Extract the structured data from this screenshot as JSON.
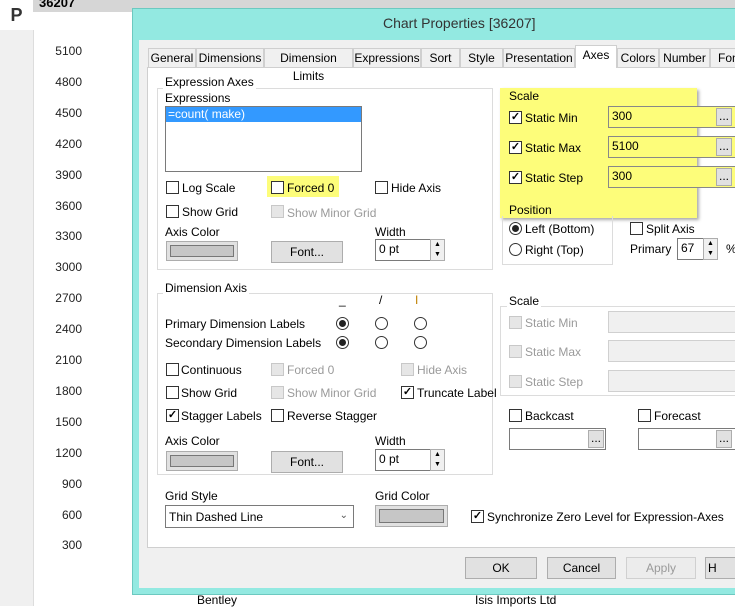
{
  "background": {
    "app_letter": "P",
    "object_id": "36207",
    "y_axis": [
      "5100",
      "4800",
      "4500",
      "4200",
      "3900",
      "3600",
      "3300",
      "3000",
      "2700",
      "2400",
      "2100",
      "1800",
      "1500",
      "1200",
      "900",
      "600",
      "300"
    ],
    "x_labels": [
      "Bentley",
      "Isis Imports Ltd"
    ]
  },
  "dialog": {
    "title": "Chart Properties [36207]",
    "accent": "#93e9e1",
    "tabs": [
      "General",
      "Dimensions",
      "Dimension Limits",
      "Expressions",
      "Sort",
      "Style",
      "Presentation",
      "Axes",
      "Colors",
      "Number",
      "Font"
    ],
    "active_tab": "Axes",
    "expr_axes": {
      "group": "Expression Axes",
      "expressions_label": "Expressions",
      "expressions": [
        "=count( make)"
      ],
      "log_scale": "Log Scale",
      "forced0": "Forced 0",
      "hide_axis": "Hide Axis",
      "show_grid": "Show Grid",
      "show_minor_grid": "Show Minor Grid",
      "axis_color": "Axis Color",
      "font": "Font...",
      "width_label": "Width",
      "width": "0 pt"
    },
    "scale": {
      "group": "Scale",
      "min_label": "Static Min",
      "min": "300",
      "max_label": "Static Max",
      "max": "5100",
      "step_label": "Static Step",
      "step": "300",
      "more": "...",
      "highlight": "#fdfd7a"
    },
    "position": {
      "group": "Position",
      "left": "Left (Bottom)",
      "right": "Right (Top)"
    },
    "split": {
      "label": "Split Axis",
      "primary": "Primary",
      "value": "67",
      "unit": "%"
    },
    "dim_axis": {
      "group": "Dimension Axis",
      "col_h": "_",
      "col_d": "/",
      "col_v": "I",
      "primary": "Primary Dimension Labels",
      "secondary": "Secondary Dimension Labels",
      "continuous": "Continuous",
      "forced0": "Forced 0",
      "hide_axis": "Hide Axis",
      "show_grid": "Show Grid",
      "show_minor_grid": "Show Minor Grid",
      "truncate": "Truncate Label",
      "stagger": "Stagger Labels",
      "reverse": "Reverse Stagger",
      "axis_color": "Axis Color",
      "font": "Font...",
      "width_label": "Width",
      "width": "0 pt"
    },
    "dim_scale": {
      "group": "Scale",
      "min": "Static Min",
      "max": "Static Max",
      "step": "Static Step",
      "backcast": "Backcast",
      "forecast": "Forecast",
      "more": "..."
    },
    "grid": {
      "style_label": "Grid Style",
      "style": "Thin Dashed Line",
      "color_label": "Grid Color",
      "sync": "Synchronize Zero Level for Expression-Axes"
    },
    "buttons": {
      "ok": "OK",
      "cancel": "Cancel",
      "apply": "Apply",
      "help": "H"
    }
  }
}
